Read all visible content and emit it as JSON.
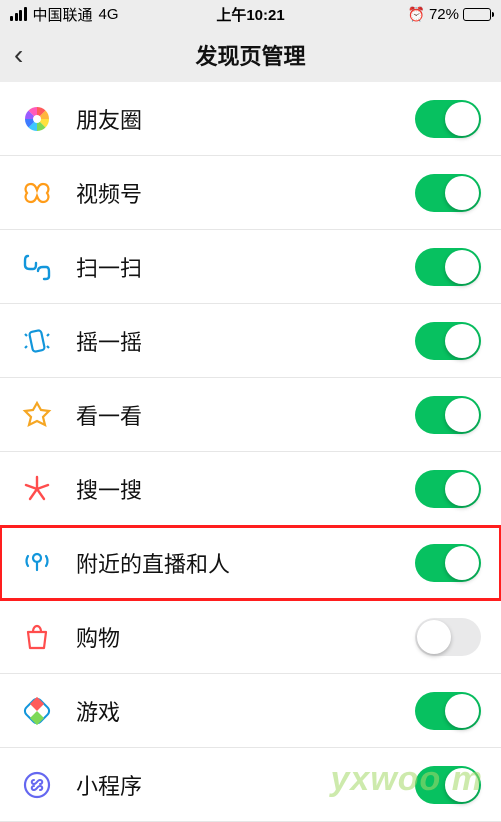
{
  "status": {
    "carrier": "中国联通",
    "network": "4G",
    "time": "上午10:21",
    "alarm": "⏰",
    "battery_pct": "72%"
  },
  "nav": {
    "back_glyph": "‹",
    "title": "发现页管理"
  },
  "rows": [
    {
      "key": "moments",
      "label": "朋友圈",
      "on": true,
      "highlight": false
    },
    {
      "key": "channels",
      "label": "视频号",
      "on": true,
      "highlight": false
    },
    {
      "key": "scan",
      "label": "扫一扫",
      "on": true,
      "highlight": false
    },
    {
      "key": "shake",
      "label": "摇一摇",
      "on": true,
      "highlight": false
    },
    {
      "key": "topstories",
      "label": "看一看",
      "on": true,
      "highlight": false
    },
    {
      "key": "search",
      "label": "搜一搜",
      "on": true,
      "highlight": false
    },
    {
      "key": "nearby",
      "label": "附近的直播和人",
      "on": true,
      "highlight": true
    },
    {
      "key": "shopping",
      "label": "购物",
      "on": false,
      "highlight": false
    },
    {
      "key": "games",
      "label": "游戏",
      "on": true,
      "highlight": false
    },
    {
      "key": "miniprog",
      "label": "小程序",
      "on": true,
      "highlight": false
    }
  ],
  "watermark": "yxwoo  m"
}
